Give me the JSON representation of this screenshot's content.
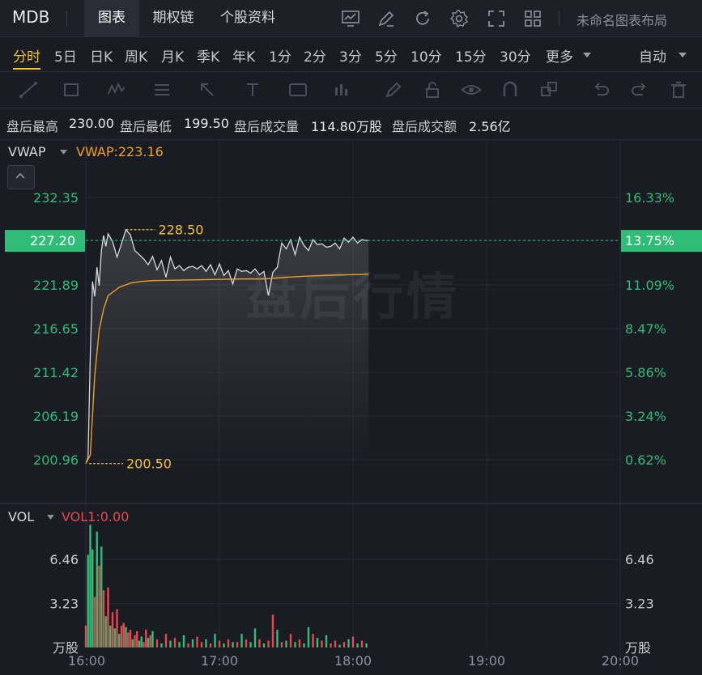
{
  "header": {
    "symbol": "MDB",
    "tabs": [
      "图表",
      "期权链",
      "个股资料"
    ],
    "active_tab": "图表",
    "layout_name": "未命名图表布局",
    "icons": [
      "chart-template-icon",
      "draw-icon",
      "refresh-icon",
      "settings-icon",
      "fullscreen-icon",
      "grid-layout-icon"
    ]
  },
  "periods": {
    "items": [
      "分时",
      "5日",
      "日K",
      "周K",
      "月K",
      "季K",
      "年K",
      "1分",
      "2分",
      "3分",
      "5分",
      "10分",
      "15分",
      "30分",
      "更多"
    ],
    "active": "分时",
    "auto_label": "自动"
  },
  "toolbar": {
    "icons": [
      "line-tool-icon",
      "rectangle-tool-icon",
      "pattern-tool-icon",
      "fib-tool-icon",
      "arrow-tool-icon",
      "text-tool-icon",
      "note-tool-icon",
      "measure-tool-icon",
      "brush-icon",
      "lock-icon",
      "eye-icon",
      "magnet-icon",
      "clone-icon",
      "undo-icon",
      "redo-icon",
      "delete-icon"
    ]
  },
  "info": {
    "high_label": "盘后最高",
    "high_value": "230.00",
    "low_label": "盘后最低",
    "low_value": "199.50",
    "vol_label": "盘后成交量",
    "vol_value": "114.80万股",
    "amount_label": "盘后成交额",
    "amount_value": "2.56亿"
  },
  "indicators": {
    "main_name": "VWAP",
    "main_value_text": "VWAP:223.16",
    "sub_name": "VOL",
    "sub_value_text": "VOL1:0.00"
  },
  "watermark": "盘后行情",
  "colors": {
    "up": "#e5484d",
    "down": "#2fbd77",
    "price_line": "#d7d9de",
    "vwap": "#f0a020",
    "highlight": "#f2c230",
    "current_bg": "#2fbd77"
  },
  "chart_data": {
    "type": "line",
    "x_ticks": [
      "16:00",
      "17:00",
      "18:00",
      "19:00",
      "20:00"
    ],
    "y_left_ticks": [
      "232.35",
      "221.89",
      "216.65",
      "211.42",
      "206.19",
      "200.96"
    ],
    "y_right_ticks": [
      "16.33%",
      "11.09%",
      "8.47%",
      "5.86%",
      "3.24%",
      "0.62%"
    ],
    "ylim": [
      198.76,
      234.55
    ],
    "current_price": "227.20",
    "current_pct": "13.75%",
    "high_marker": "228.50",
    "low_marker": "200.50",
    "price_series": {
      "name": "price",
      "x": [
        "16:00",
        "16:01",
        "16:02",
        "16:03",
        "16:04",
        "16:05",
        "16:06",
        "16:07",
        "16:08",
        "16:09",
        "16:10",
        "16:12",
        "16:14",
        "16:16",
        "16:18",
        "16:20",
        "16:22",
        "16:24",
        "16:26",
        "16:28",
        "16:30",
        "16:32",
        "16:34",
        "16:36",
        "16:38",
        "16:40",
        "16:42",
        "16:44",
        "16:46",
        "16:48",
        "16:50",
        "16:52",
        "16:54",
        "16:56",
        "16:58",
        "17:00",
        "17:02",
        "17:04",
        "17:06",
        "17:08",
        "17:10",
        "17:12",
        "17:14",
        "17:16",
        "17:18",
        "17:20",
        "17:22",
        "17:24",
        "17:26",
        "17:28",
        "17:30",
        "17:32",
        "17:34",
        "17:36",
        "17:38",
        "17:40",
        "17:42",
        "17:44",
        "17:46",
        "17:48",
        "17:50",
        "17:52",
        "17:54",
        "17:56",
        "17:58",
        "18:00",
        "18:02",
        "18:04",
        "18:06",
        "18:07"
      ],
      "values": [
        200.5,
        201.2,
        213.5,
        222.3,
        220.5,
        224.0,
        221.8,
        226.0,
        227.8,
        226.5,
        228.0,
        227.1,
        225.2,
        226.8,
        228.5,
        227.9,
        226.0,
        225.5,
        225.0,
        224.3,
        225.3,
        223.7,
        224.8,
        222.8,
        225.2,
        223.8,
        224.2,
        223.6,
        224.0,
        224.1,
        223.8,
        224.2,
        223.5,
        224.3,
        223.1,
        224.4,
        223.0,
        223.6,
        222.0,
        223.8,
        223.5,
        223.6,
        223.3,
        223.8,
        223.1,
        223.5,
        220.6,
        223.4,
        224.0,
        226.9,
        226.2,
        227.3,
        225.5,
        227.6,
        226.6,
        226.0,
        227.3,
        226.7,
        226.8,
        226.4,
        226.5,
        226.9,
        226.2,
        227.5,
        227.0,
        227.6,
        226.9,
        227.3,
        227.2,
        227.2
      ]
    },
    "vwap_series": {
      "name": "VWAP",
      "x": [
        "16:00",
        "16:02",
        "16:04",
        "16:06",
        "16:08",
        "16:10",
        "16:15",
        "16:20",
        "16:25",
        "16:30",
        "16:40",
        "16:50",
        "17:00",
        "17:10",
        "17:20",
        "17:30",
        "17:40",
        "17:50",
        "18:00",
        "18:07"
      ],
      "values": [
        200.5,
        201.5,
        211.0,
        216.5,
        219.0,
        220.6,
        221.6,
        222.1,
        222.3,
        222.4,
        222.45,
        222.5,
        222.55,
        222.6,
        222.6,
        222.8,
        222.95,
        223.05,
        223.12,
        223.16
      ]
    },
    "volume": {
      "unit": "万股",
      "y_ticks": [
        "6.46",
        "3.23"
      ],
      "ylim": [
        0,
        9.2
      ],
      "x": [
        "16:00",
        "16:01",
        "16:02",
        "16:03",
        "16:04",
        "16:05",
        "16:06",
        "16:07",
        "16:08",
        "16:09",
        "16:10",
        "16:11",
        "16:12",
        "16:13",
        "16:14",
        "16:15",
        "16:16",
        "16:17",
        "16:18",
        "16:19",
        "16:20",
        "16:21",
        "16:22",
        "16:23",
        "16:24",
        "16:25",
        "16:26",
        "16:27",
        "16:28",
        "16:29",
        "16:30",
        "16:32",
        "16:34",
        "16:36",
        "16:38",
        "16:40",
        "16:42",
        "16:44",
        "16:46",
        "16:48",
        "16:50",
        "16:52",
        "16:54",
        "16:56",
        "16:58",
        "17:00",
        "17:02",
        "17:04",
        "17:06",
        "17:08",
        "17:10",
        "17:12",
        "17:14",
        "17:16",
        "17:18",
        "17:20",
        "17:22",
        "17:24",
        "17:26",
        "17:28",
        "17:30",
        "17:32",
        "17:34",
        "17:36",
        "17:38",
        "17:40",
        "17:42",
        "17:44",
        "17:46",
        "17:48",
        "17:50",
        "17:52",
        "17:54",
        "17:56",
        "17:58",
        "18:00",
        "18:02",
        "18:04",
        "18:06"
      ],
      "values": [
        1.6,
        6.8,
        9.0,
        7.2,
        3.7,
        8.5,
        6.0,
        7.4,
        4.2,
        2.3,
        4.4,
        1.6,
        2.6,
        1.4,
        2.8,
        1.0,
        1.6,
        1.8,
        1.5,
        1.1,
        1.3,
        0.6,
        0.9,
        1.2,
        0.5,
        0.8,
        0.4,
        1.3,
        0.7,
        0.9,
        1.2,
        0.6,
        0.3,
        1.0,
        0.5,
        0.7,
        0.4,
        0.9,
        0.3,
        0.6,
        0.8,
        0.4,
        0.6,
        0.3,
        1.0,
        0.5,
        0.3,
        0.6,
        0.4,
        0.4,
        1.0,
        0.6,
        0.4,
        1.4,
        0.6,
        0.3,
        0.5,
        2.4,
        1.3,
        0.4,
        0.5,
        1.0,
        0.4,
        0.6,
        0.3,
        1.5,
        1.0,
        0.7,
        0.5,
        0.9,
        0.3,
        0.5,
        0.2,
        0.4,
        0.6,
        0.8,
        0.3,
        0.5,
        0.3
      ],
      "colors": [
        "u",
        "d",
        "d",
        "d",
        "u",
        "d",
        "u",
        "d",
        "u",
        "d",
        "u",
        "d",
        "u",
        "d",
        "u",
        "d",
        "u",
        "u",
        "d",
        "u",
        "u",
        "d",
        "u",
        "u",
        "d",
        "d",
        "u",
        "u",
        "d",
        "u",
        "d",
        "u",
        "d",
        "u",
        "d",
        "u",
        "d",
        "d",
        "u",
        "d",
        "u",
        "u",
        "d",
        "u",
        "d",
        "u",
        "d",
        "u",
        "d",
        "u",
        "d",
        "u",
        "d",
        "d",
        "u",
        "d",
        "u",
        "u",
        "d",
        "u",
        "d",
        "u",
        "d",
        "u",
        "d",
        "d",
        "u",
        "d",
        "u",
        "d",
        "u",
        "u",
        "d",
        "u",
        "d",
        "u",
        "d",
        "u",
        "d"
      ]
    }
  }
}
